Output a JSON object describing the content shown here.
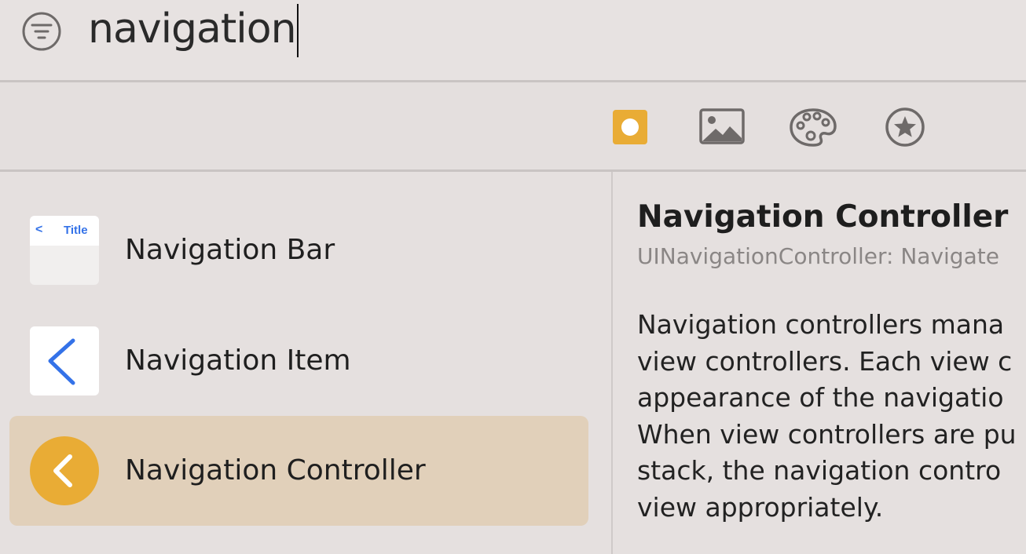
{
  "search": {
    "query": "navigation"
  },
  "icons": {
    "filter": "filter-icon",
    "objects": "objects-library-icon",
    "media": "media-library-icon",
    "colors": "color-palette-icon",
    "favorites": "favorites-star-icon"
  },
  "colors": {
    "accent": "#e9ac35",
    "selection": "#e1d0ba",
    "link_blue": "#3472e8",
    "secondary_text": "#8a8685"
  },
  "library": {
    "items": [
      {
        "label": "Navigation Bar",
        "thumb_back": "<",
        "thumb_title": "Title",
        "selected": false
      },
      {
        "label": "Navigation Item",
        "selected": false
      },
      {
        "label": "Navigation Controller",
        "selected": true
      }
    ]
  },
  "detail": {
    "title": "Navigation Controller",
    "subtitle": "UINavigationController: Navigate",
    "description_lines": [
      "Navigation controllers mana",
      "view controllers. Each view c",
      "appearance of the navigatio",
      "When view controllers are pu",
      "stack, the navigation contro",
      "view appropriately."
    ]
  }
}
